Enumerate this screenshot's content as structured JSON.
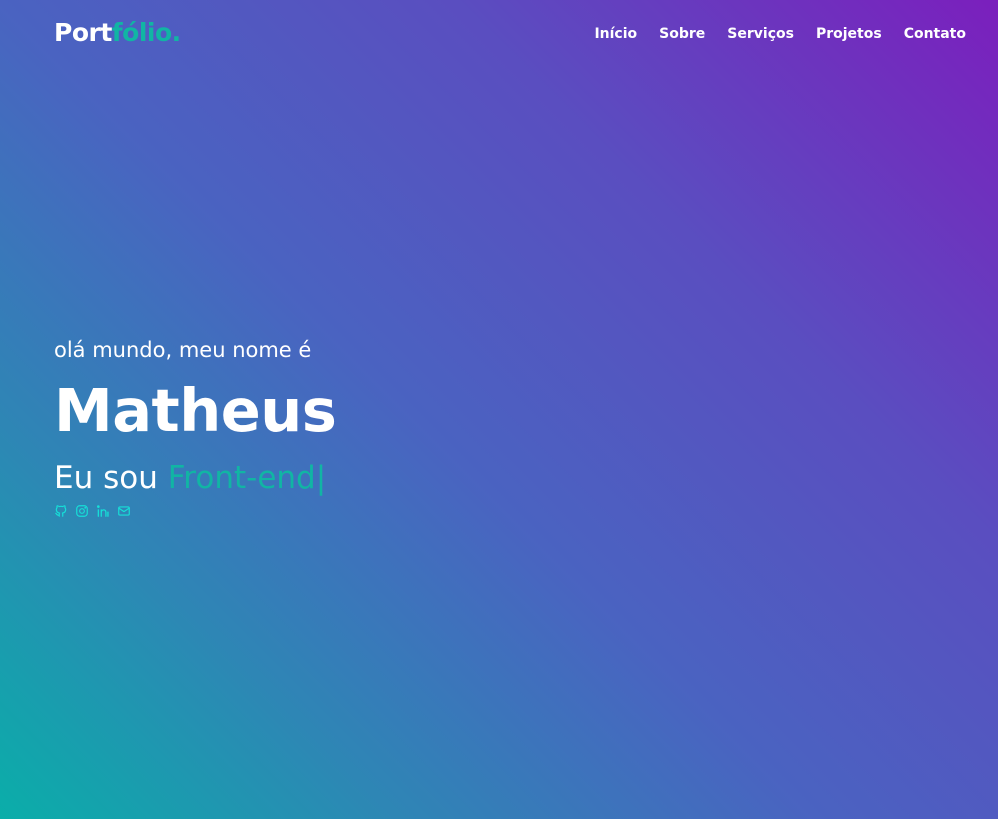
{
  "logo": {
    "part1": "Port",
    "part2": "fólio."
  },
  "nav": {
    "items": [
      {
        "label": "Início"
      },
      {
        "label": "Sobre"
      },
      {
        "label": "Serviços"
      },
      {
        "label": "Projetos"
      },
      {
        "label": "Contato"
      }
    ]
  },
  "hero": {
    "greeting": "olá mundo, meu nome é",
    "name": "Matheus",
    "role_prefix": "Eu sou",
    "role_typed": "Front-end",
    "cursor": "|"
  },
  "socials": {
    "icons": [
      "github-icon",
      "instagram-icon",
      "linkedin-icon",
      "mail-icon"
    ]
  },
  "colors": {
    "accent": "#11b5a4",
    "icon": "#16e0d8",
    "gradient_start": "#0aaea9",
    "gradient_end": "#7b1fbd"
  }
}
